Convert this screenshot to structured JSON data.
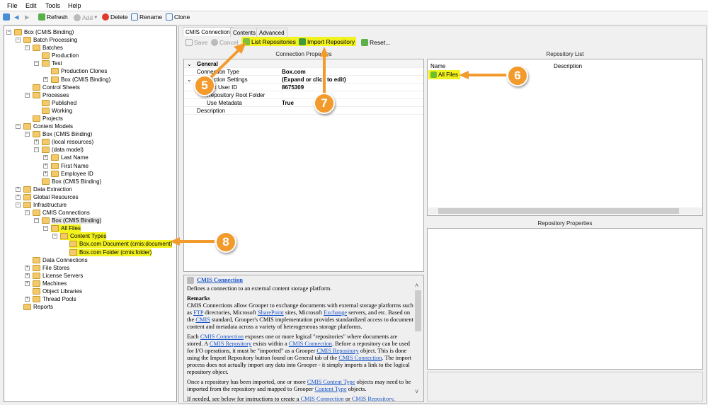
{
  "menu": [
    "File",
    "Edit",
    "Tools",
    "Help"
  ],
  "toolbar": {
    "refresh": "Refresh",
    "add": "Add",
    "delete": "Delete",
    "rename": "Rename",
    "clone": "Clone"
  },
  "tree": [
    {
      "label": "Box (CMIS Binding)",
      "level": 0,
      "exp": "-"
    },
    {
      "label": "Batch Processing",
      "level": 1,
      "exp": "-"
    },
    {
      "label": "Batches",
      "level": 2,
      "exp": "-"
    },
    {
      "label": "Production",
      "level": 3
    },
    {
      "label": "Test",
      "level": 3,
      "exp": "-"
    },
    {
      "label": "Production Clones",
      "level": 4
    },
    {
      "label": "Box (CMIS Binding)",
      "level": 4,
      "exp": "+"
    },
    {
      "label": "Control Sheets",
      "level": 2
    },
    {
      "label": "Processes",
      "level": 2,
      "exp": "-"
    },
    {
      "label": "Published",
      "level": 3
    },
    {
      "label": "Working",
      "level": 3
    },
    {
      "label": "Projects",
      "level": 2
    },
    {
      "label": "Content Models",
      "level": 1,
      "exp": "-"
    },
    {
      "label": "Box (CMIS Binding)",
      "level": 2,
      "exp": "-"
    },
    {
      "label": "(local resources)",
      "level": 3,
      "exp": "+"
    },
    {
      "label": "(data model)",
      "level": 3,
      "exp": "-"
    },
    {
      "label": "Last Name",
      "level": 4,
      "exp": "+"
    },
    {
      "label": "First Name",
      "level": 4,
      "exp": "+"
    },
    {
      "label": "Employee ID",
      "level": 4,
      "exp": "+"
    },
    {
      "label": "Box (CMIS Binding)",
      "level": 3
    },
    {
      "label": "Data Extraction",
      "level": 1,
      "exp": "+"
    },
    {
      "label": "Global Resources",
      "level": 1,
      "exp": "+"
    },
    {
      "label": "Infrastructure",
      "level": 1,
      "exp": "-"
    },
    {
      "label": "CMIS Connections",
      "level": 2,
      "exp": "-"
    },
    {
      "label": "Box (CMIS Binding)",
      "level": 3,
      "exp": "-",
      "selected": true
    },
    {
      "label": "All Files",
      "level": 4,
      "exp": "-",
      "hl": true
    },
    {
      "label": "Content Types",
      "level": 5,
      "exp": "-",
      "hl": true
    },
    {
      "label": "Box.com Document (cmis:document)",
      "level": 6,
      "hl": true
    },
    {
      "label": "Box.com Folder (cmis:folder)",
      "level": 6,
      "hl": true
    },
    {
      "label": "Data Connections",
      "level": 2
    },
    {
      "label": "File Stores",
      "level": 2,
      "exp": "+"
    },
    {
      "label": "License Servers",
      "level": 2,
      "exp": "+"
    },
    {
      "label": "Machines",
      "level": 2,
      "exp": "+"
    },
    {
      "label": "Object Libraries",
      "level": 2
    },
    {
      "label": "Thread Pools",
      "level": 2,
      "exp": "+"
    },
    {
      "label": "Reports",
      "level": 1
    }
  ],
  "tabs": [
    "CMIS Connection",
    "Contents",
    "Advanced"
  ],
  "actions": {
    "save": "Save",
    "cancel": "Cancel",
    "list": "List Repositories",
    "import": "Import Repository",
    "reset": "Reset..."
  },
  "connection_properties": {
    "title": "Connection Properties",
    "group": "General",
    "rows": [
      {
        "name": "Connection Type",
        "value": "Box.com",
        "indent": 0
      },
      {
        "name": "Connection Settings",
        "value": "(Expand or click to edit)",
        "indent": 0,
        "exp": true
      },
      {
        "name": "Box User ID",
        "value": "8675309",
        "indent": 1
      },
      {
        "name": "Repository Root Folder",
        "value": "",
        "indent": 1
      },
      {
        "name": "Use Metadata",
        "value": "True",
        "indent": 1
      },
      {
        "name": "Description",
        "value": "",
        "indent": 0
      }
    ]
  },
  "repository_list": {
    "title": "Repository List",
    "columns": [
      "Name",
      "Description"
    ],
    "items": [
      "All Files"
    ]
  },
  "repository_properties": {
    "title": "Repository Properties"
  },
  "help": {
    "title": "CMIS Connection",
    "summary": "Defines a connection to an external content storage platform.",
    "remarks": "Remarks",
    "paragraphs": [
      [
        [
          "CMIS Connections allow Grooper to exchange documents with external storage platforms such as ",
          0
        ],
        [
          "FTP",
          1
        ],
        [
          " directories, Microsoft ",
          0
        ],
        [
          "SharePoint",
          1
        ],
        [
          " sites, Microsoft ",
          0
        ],
        [
          "Exchange",
          1
        ],
        [
          " servers, and etc. Based on the ",
          0
        ],
        [
          "CMIS",
          1
        ],
        [
          " standard, Grooper's CMIS implementation provides standardized access to document content and metadata across a variety of heterogeneous storage platforms.",
          0
        ]
      ],
      [
        [
          "Each ",
          0
        ],
        [
          "CMIS Connection",
          1
        ],
        [
          " exposes one or more logical \"repositories\" where documents are stored. A ",
          0
        ],
        [
          "CMIS Repository",
          1
        ],
        [
          " exists within a ",
          0
        ],
        [
          "CMIS Connection",
          1
        ],
        [
          ". Before a repository can be used for I/O operations, it must be \"imported\" as a Grooper ",
          0
        ],
        [
          "CMIS Repository",
          1
        ],
        [
          " object. This is done using the Import Repository button found on General tab of the ",
          0
        ],
        [
          "CMIS Connection",
          1
        ],
        [
          ". The import process does not actually import any data into Grooper - it simply imports a link to the logical repository object.",
          0
        ]
      ],
      [
        [
          "Once a repository has been imported, one or more ",
          0
        ],
        [
          "CMIS Content Type",
          1
        ],
        [
          " objects may need to be imported from the repository and mapped to Grooper ",
          0
        ],
        [
          "Content Type",
          1
        ],
        [
          " objects.",
          0
        ]
      ],
      [
        [
          "If needed, see below for instructions to create a ",
          0
        ],
        [
          "CMIS Connection",
          1
        ],
        [
          " or ",
          0
        ],
        [
          "CMIS Repository",
          1
        ],
        [
          ".",
          0
        ]
      ]
    ]
  },
  "callouts": [
    "5",
    "6",
    "7",
    "8"
  ],
  "colors": {
    "highlight": "#f2f21e",
    "callout": "#f39a2c",
    "link": "#1a55c8"
  }
}
